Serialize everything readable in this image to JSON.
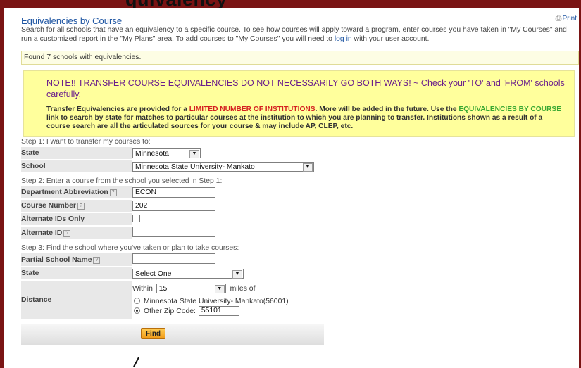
{
  "header": {
    "banner_text": "quivalency"
  },
  "page": {
    "title": "Equivalencies by Course",
    "print_label": "Print",
    "intro_part1": "Search for all schools that have an equivalency to a specific course. To see how courses will apply toward a program, enter courses you have taken in \"My Courses\" and run a customized report in the \"My Plans\" area. To add courses to \"My Courses\" you will need to ",
    "login_link": "log in",
    "intro_part2": " with your user account.",
    "found_text": "Found 7 schools with equivalencies."
  },
  "note": {
    "heading": "NOTE!! TRANSFER COURSE EQUIVALENCIES DO NOT NECESSARILY GO BOTH WAYS! ~ Check your 'TO' and 'FROM' schools carefully.",
    "body_part1": "Transfer Equivalencies are provided for a ",
    "body_red": "LIMITED NUMBER OF INSTITUTIONS",
    "body_part2": ". More will be added in the future. Use the ",
    "body_green": "EQUIVALENCIES BY COURSE",
    "body_part3": " link to search by state for matches to particular courses at the institution to which you are planning to transfer. Institutions shown as a result of a course search are all the articulated sources for your course & may include AP, CLEP, etc."
  },
  "step1": {
    "label": "Step 1: I want to transfer my courses to:",
    "state_label": "State",
    "state_value": "Minnesota",
    "school_label": "School",
    "school_value": "Minnesota State University- Mankato"
  },
  "step2": {
    "label": "Step 2: Enter a course from the school you selected in Step 1:",
    "dept_label": "Department Abbreviation",
    "dept_value": "ECON",
    "course_label": "Course Number",
    "course_value": "202",
    "alt_only_label": "Alternate IDs Only",
    "alt_id_label": "Alternate ID",
    "alt_id_value": ""
  },
  "step3": {
    "label": "Step 3: Find the school where you've taken or plan to take courses:",
    "partial_label": "Partial School Name",
    "partial_value": "",
    "state_label": "State",
    "state_value": "Select One",
    "distance_label": "Distance",
    "within_label": "Within",
    "within_value": "15",
    "miles_label": "miles of",
    "radio1_label": "Minnesota State University- Mankato(56001)",
    "radio2_label": "Other Zip Code:",
    "zip_value": "55101"
  },
  "actions": {
    "find_label": "Find"
  },
  "icons": {
    "help": "?",
    "print": "print-icon",
    "dropdown": "▼"
  }
}
